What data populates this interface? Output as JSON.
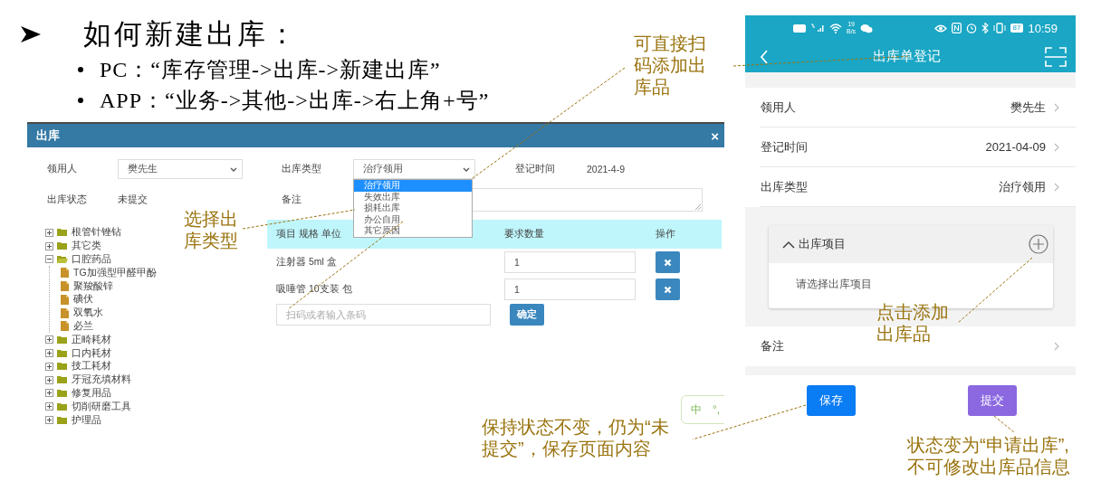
{
  "heading": {
    "text": "如何新建出库：",
    "bullets": [
      "PC：“库存管理->出库->新建出库”",
      "APP：“业务->其他->出库->右上角+号”"
    ]
  },
  "pc_window": {
    "title": "出库",
    "close": "×",
    "form": [
      {
        "kind": "select",
        "label": "领用人",
        "value": "樊先生"
      },
      {
        "kind": "dropdown",
        "label": "出库类型",
        "value": "治疗领用",
        "options": [
          {
            "label": "治疗领用",
            "selected": true
          },
          {
            "label": "失效出库",
            "selected": false
          },
          {
            "label": "损耗出库",
            "selected": false
          },
          {
            "label": "办公自用",
            "selected": false
          },
          {
            "label": "其它原因",
            "selected": false
          }
        ]
      },
      {
        "kind": "text",
        "label": "登记时间",
        "value": "2021-4-9"
      },
      {
        "kind": "text",
        "label": "出库状态",
        "value": "未提交"
      },
      {
        "kind": "textarea",
        "label": "备注"
      }
    ],
    "tree": [
      {
        "kind": "folder",
        "label": "根管针锉钻",
        "expanded": false
      },
      {
        "kind": "folder",
        "label": "其它类",
        "expanded": false
      },
      {
        "kind": "folder",
        "label": "口腔药品",
        "expanded": true,
        "children": [
          {
            "kind": "file",
            "label": "TG加强型甲醛甲酚"
          },
          {
            "kind": "file",
            "label": "聚羧酸锌"
          },
          {
            "kind": "file",
            "label": "碘伏"
          },
          {
            "kind": "file",
            "label": "双氧水"
          },
          {
            "kind": "file",
            "label": "必兰"
          }
        ]
      },
      {
        "kind": "folder",
        "label": "正畸耗材",
        "expanded": false
      },
      {
        "kind": "folder",
        "label": "口内耗材",
        "expanded": false
      },
      {
        "kind": "folder",
        "label": "技工耗材",
        "expanded": false
      },
      {
        "kind": "folder",
        "label": "牙冠充填材料",
        "expanded": false
      },
      {
        "kind": "folder",
        "label": "修复用品",
        "expanded": false
      },
      {
        "kind": "folder",
        "label": "切削研磨工具",
        "expanded": false
      },
      {
        "kind": "folder",
        "label": "护理品",
        "expanded": false
      }
    ],
    "table": {
      "columns": [
        "项目 规格 单位",
        "要求数量",
        "操作"
      ],
      "rows": [
        {
          "item": "注射器 5ml 盒",
          "quantity": "1"
        },
        {
          "item": "吸唾管 10支装 包",
          "quantity": "1"
        }
      ]
    },
    "scan_field": {
      "placeholder": "扫码或者输入条码"
    },
    "confirm_button": "确定"
  },
  "phone": {
    "status_bar": {
      "speed": "19",
      "speed_unit": "B/s",
      "battery": "87",
      "time": "10:59"
    },
    "title": "出库单登记",
    "rows": [
      {
        "label": "领用人",
        "value": "樊先生"
      },
      {
        "label": "登记时间",
        "value": "2021-04-09"
      },
      {
        "label": "出库类型",
        "value": "治疗领用"
      }
    ],
    "items_card": {
      "title": "出库项目",
      "expanded": true,
      "placeholder": "请选择出库项目"
    },
    "remark_row": {
      "label": "备注"
    },
    "buttons": [
      {
        "label": "保存",
        "kind": "primary"
      },
      {
        "label": "提交",
        "kind": "submit"
      }
    ]
  },
  "ime_popup": {
    "texts": [
      "中",
      "°,"
    ]
  },
  "callouts": [
    {
      "lines": [
        "可直接扫",
        "码添加出",
        "库品"
      ]
    },
    {
      "lines": [
        "选择出",
        "库类型"
      ]
    },
    {
      "lines": [
        "点击添加",
        "出库品"
      ]
    },
    {
      "lines": [
        "保持状态不变，仍为“未",
        "提交”，保存页面内容"
      ]
    },
    {
      "lines": [
        "状态变为“申请出库”,",
        "不可修改出库品信息"
      ]
    }
  ]
}
